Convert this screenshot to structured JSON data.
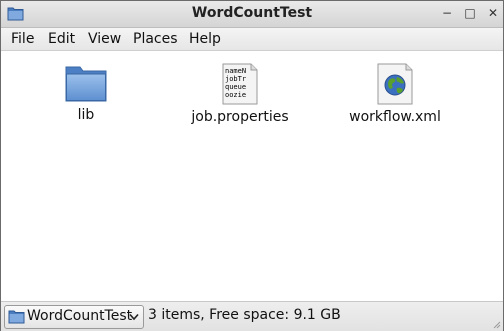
{
  "window": {
    "title": "WordCountTest",
    "controls": {
      "minimize": "−",
      "maximize": "□",
      "close": "✕"
    }
  },
  "menubar": {
    "file": "File",
    "edit": "Edit",
    "view": "View",
    "places": "Places",
    "help": "Help"
  },
  "files": [
    {
      "label": "lib",
      "icon": "folder-icon"
    },
    {
      "label": "job.properties",
      "icon": "text-document-icon",
      "preview": [
        "nameN",
        "jobTr",
        "queue",
        "oozie"
      ]
    },
    {
      "label": "workflow.xml",
      "icon": "xml-globe-document-icon"
    }
  ],
  "statusbar": {
    "location": "WordCountTest",
    "status": "3 items, Free space: 9.1 GB"
  },
  "colors": {
    "folder_blue": "#6f9fd8",
    "titlebar": "#dcdcdc",
    "globe_green": "#5aa02c",
    "globe_blue": "#3b6fc0"
  }
}
